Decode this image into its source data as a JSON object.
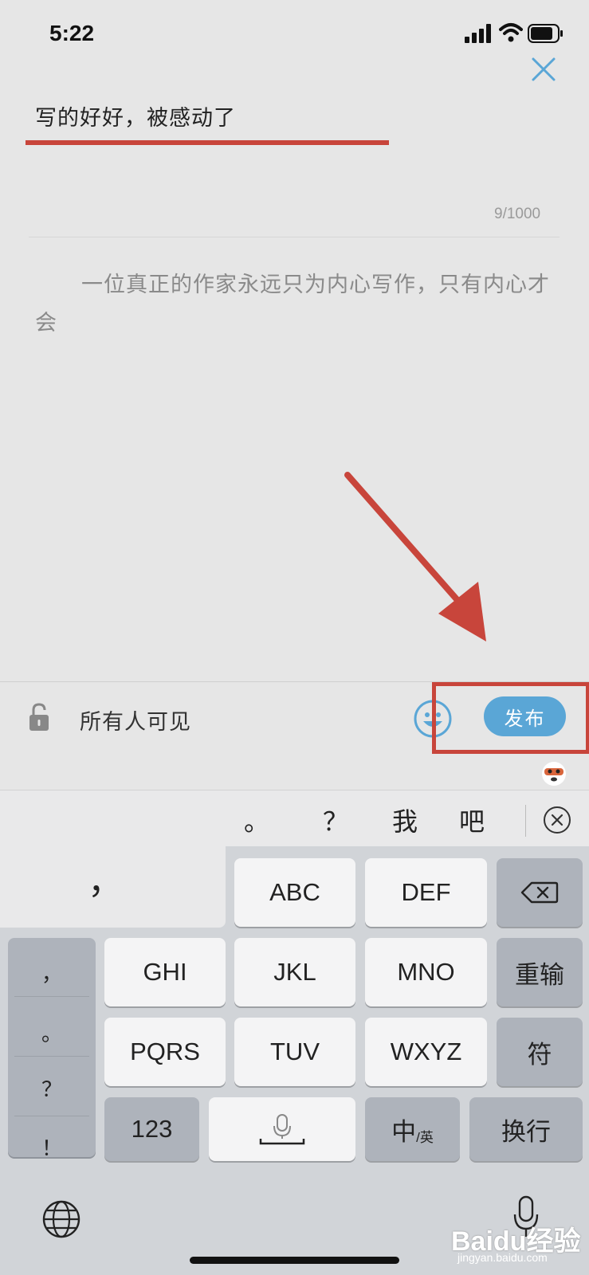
{
  "status_bar": {
    "time": "5:22"
  },
  "editor": {
    "title": "写的好好，被感动了",
    "char_count": "9/1000",
    "body": "一位真正的作家永远只为内心写作，只有内心才会"
  },
  "toolbar": {
    "visibility_label": "所有人可见",
    "publish_label": "发布"
  },
  "candidates": [
    "。",
    "？",
    "我",
    "吧"
  ],
  "keyboard": {
    "comma_key": "，",
    "punct_keys": [
      "，",
      "。",
      "？",
      "！"
    ],
    "row1": [
      "ABC",
      "DEF"
    ],
    "row2": [
      "GHI",
      "JKL",
      "MNO"
    ],
    "retype_label": "重输",
    "row3": [
      "PQRS",
      "TUV",
      "WXYZ"
    ],
    "symbol_label": "符",
    "num_label": "123",
    "lang_main": "中",
    "lang_sub": "/英",
    "newline_label": "换行"
  },
  "watermark": {
    "brand": "Baidu经验",
    "site": "jingyan.baidu.com"
  },
  "colors": {
    "accent": "#5aa6d6",
    "annotation": "#c8453b"
  }
}
